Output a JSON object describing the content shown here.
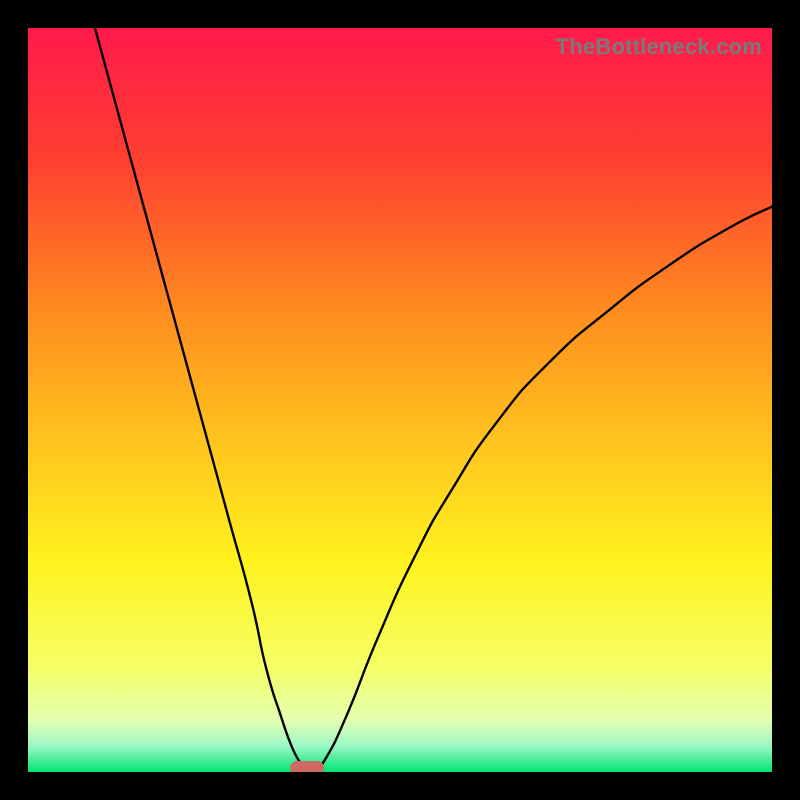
{
  "watermark": "TheBottleneck.com",
  "colors": {
    "frame": "#000000",
    "gradient_stops": [
      {
        "offset": 0.0,
        "color": "#ff1a4b"
      },
      {
        "offset": 0.18,
        "color": "#ff4030"
      },
      {
        "offset": 0.38,
        "color": "#ff8c1f"
      },
      {
        "offset": 0.55,
        "color": "#ffc21e"
      },
      {
        "offset": 0.72,
        "color": "#fff31e"
      },
      {
        "offset": 0.86,
        "color": "#f5ff66"
      },
      {
        "offset": 0.93,
        "color": "#e4ffb0"
      },
      {
        "offset": 0.965,
        "color": "#9cf7c6"
      },
      {
        "offset": 1.0,
        "color": "#00e472"
      }
    ],
    "curve": "#000000",
    "marker": "#cf6a63"
  },
  "chart_data": {
    "type": "line",
    "title": "",
    "xlabel": "",
    "ylabel": "",
    "xlim": [
      0,
      100
    ],
    "ylim": [
      0,
      100
    ],
    "series": [
      {
        "name": "left-branch",
        "x": [
          9,
          12,
          15,
          18,
          21,
          24,
          27,
          30,
          32,
          34,
          35.5,
          36.8,
          37
        ],
        "y": [
          100,
          89,
          78,
          67,
          56,
          45,
          34,
          23,
          14,
          7.5,
          3.3,
          0.9,
          0.3
        ]
      },
      {
        "name": "right-branch",
        "x": [
          38.5,
          40,
          43,
          47,
          52,
          57,
          63,
          70,
          78,
          86,
          94,
          100
        ],
        "y": [
          0.3,
          1.8,
          8,
          18,
          29,
          38,
          47,
          55,
          62,
          68,
          73,
          76
        ]
      }
    ],
    "marker": {
      "x": 37.5,
      "y": 0.1,
      "label": ""
    },
    "annotations": [
      {
        "text": "TheBottleneck.com",
        "position": "top-right"
      }
    ]
  }
}
